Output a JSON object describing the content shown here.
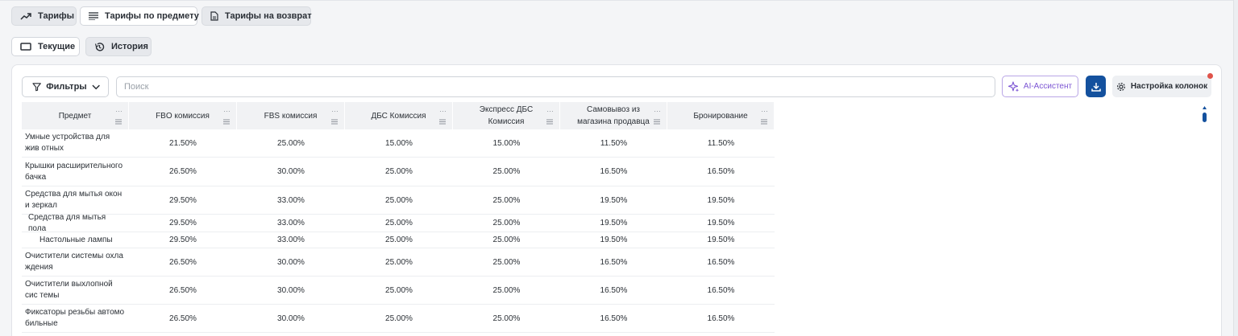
{
  "top_tabs": [
    {
      "label": "Тарифы",
      "icon": "trend-up-icon",
      "active": true
    },
    {
      "label": "Тарифы по предмету",
      "icon": "list-icon",
      "active": false
    },
    {
      "label": "Тарифы на возврат",
      "icon": "document-icon",
      "active": true
    }
  ],
  "sub_tabs": [
    {
      "label": "Текущие",
      "icon": "rectangle-icon"
    },
    {
      "label": "История",
      "icon": "history-icon"
    }
  ],
  "toolbar": {
    "filters_label": "Фильтры",
    "search_placeholder": "Поиск",
    "ai_label": "AI-Ассистент",
    "columns_label": "Настройка колонок"
  },
  "colors": {
    "accent": "#14519e",
    "ai_purple": "#7b54d3",
    "notification_dot": "#e0534a"
  },
  "table": {
    "headers": [
      "Предмет",
      "FBO комиссия",
      "FBS комиссия",
      "ДБС Комиссия",
      "Экспресс ДБС Комиссия",
      "Самовывоз из магазина продавца",
      "Бронирование"
    ],
    "rows": [
      {
        "name": "Умные устройства для жив отных",
        "values": [
          "21.50%",
          "25.00%",
          "15.00%",
          "15.00%",
          "11.50%",
          "11.50%"
        ]
      },
      {
        "name": "Крышки расширительного бачка",
        "values": [
          "26.50%",
          "30.00%",
          "25.00%",
          "25.00%",
          "16.50%",
          "16.50%"
        ]
      },
      {
        "name": "Средства для мытья окон и зеркал",
        "values": [
          "29.50%",
          "33.00%",
          "25.00%",
          "25.00%",
          "19.50%",
          "19.50%"
        ]
      },
      {
        "name": "Средства для мытья пола",
        "values": [
          "29.50%",
          "33.00%",
          "25.00%",
          "25.00%",
          "19.50%",
          "19.50%"
        ]
      },
      {
        "name": "Настольные лампы",
        "values": [
          "29.50%",
          "33.00%",
          "25.00%",
          "25.00%",
          "19.50%",
          "19.50%"
        ]
      },
      {
        "name": "Очистители системы охла ждения",
        "values": [
          "26.50%",
          "30.00%",
          "25.00%",
          "25.00%",
          "16.50%",
          "16.50%"
        ]
      },
      {
        "name": "Очистители выхлопной сис темы",
        "values": [
          "26.50%",
          "30.00%",
          "25.00%",
          "25.00%",
          "16.50%",
          "16.50%"
        ]
      },
      {
        "name": "Фиксаторы резьбы автомо бильные",
        "values": [
          "26.50%",
          "30.00%",
          "25.00%",
          "25.00%",
          "16.50%",
          "16.50%"
        ]
      }
    ]
  }
}
